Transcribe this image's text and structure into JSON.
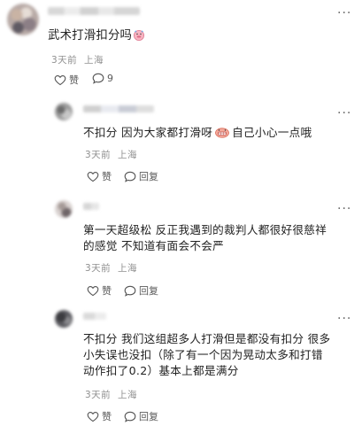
{
  "main_comment": {
    "text": "武术打滑扣分吗",
    "time": "3天前",
    "location": "上海",
    "like_label": "赞",
    "reply_count": "9"
  },
  "replies": [
    {
      "text_part1": "不扣分 因为大家都打滑呀",
      "text_part2": "自己小心一点哦",
      "time": "3天前",
      "location": "上海",
      "like_label": "赞",
      "reply_label": "回复"
    },
    {
      "line1": "第一天超级松 反正我遇到的裁判人都很好很慈祥",
      "line2": "的感觉 不知道有面会不会严",
      "time": "3天前",
      "location": "上海",
      "like_label": "赞",
      "reply_label": "回复"
    },
    {
      "line1": "不扣分 我们这组超多人打滑但是都没有扣分 很多",
      "line2": "小失误也没扣（除了有一个因为晃动太多和打错",
      "line3": "动作扣了0.2）基本上都是满分",
      "time": "3天前",
      "location": "上海",
      "like_label": "赞",
      "reply_label": "回复"
    }
  ],
  "more_glyph": "···",
  "icons": {
    "like": "heart-outline-icon",
    "comment": "speech-bubble-icon",
    "emoji_main": "pig-face-emoji-icon",
    "emoji_reply": "grimace-emoji-icon",
    "more": "more-dots-icon"
  }
}
